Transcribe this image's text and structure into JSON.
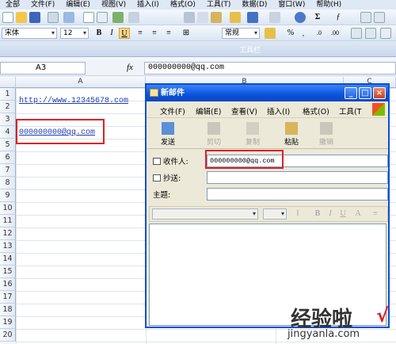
{
  "excel": {
    "menu": [
      "全部",
      "文件(F)",
      "编辑(E)",
      "视图(V)",
      "插入(I)",
      "格式(O)",
      "工具(T)",
      "数据(D)",
      "窗口(W)",
      "帮助(H)"
    ],
    "font_name": "宋体",
    "font_size": "12",
    "number_format": "常规",
    "toolbar_band_label": "工具栏",
    "name_box": "A3",
    "fx_symbol": "fx",
    "formula_value": "000000000@qq.com",
    "columns": [
      "A",
      "B",
      "C"
    ],
    "rows": [
      "1",
      "2",
      "3",
      "4",
      "5",
      "6",
      "7",
      "8",
      "9",
      "10",
      "11",
      "12",
      "13",
      "14",
      "15",
      "16",
      "17",
      "18",
      "19",
      "20"
    ],
    "cells": {
      "a1": "http://www.12345678.com",
      "a3": "000000000@qq.com"
    }
  },
  "mail": {
    "title": "新邮件",
    "menu": [
      "文件(F)",
      "编辑(E)",
      "查看(V)",
      "插入(I)",
      "格式(O)",
      "工具(T"
    ],
    "tools": {
      "send": "发送",
      "cut": "剪切",
      "copy": "复制",
      "paste": "粘贴",
      "undo": "撤销"
    },
    "to_label": "收件人:",
    "cc_label": "抄送:",
    "subject_label": "主题:",
    "to_value": "000000000@qq.com",
    "cc_value": "",
    "subject_value": ""
  },
  "watermark": {
    "text": "经验啦",
    "url": "jingyanla.com",
    "mark": "√"
  },
  "colors": {
    "highlight_box": "#e01f26",
    "hyperlink": "#1f3fb4",
    "xp_title": "#0a53db"
  }
}
